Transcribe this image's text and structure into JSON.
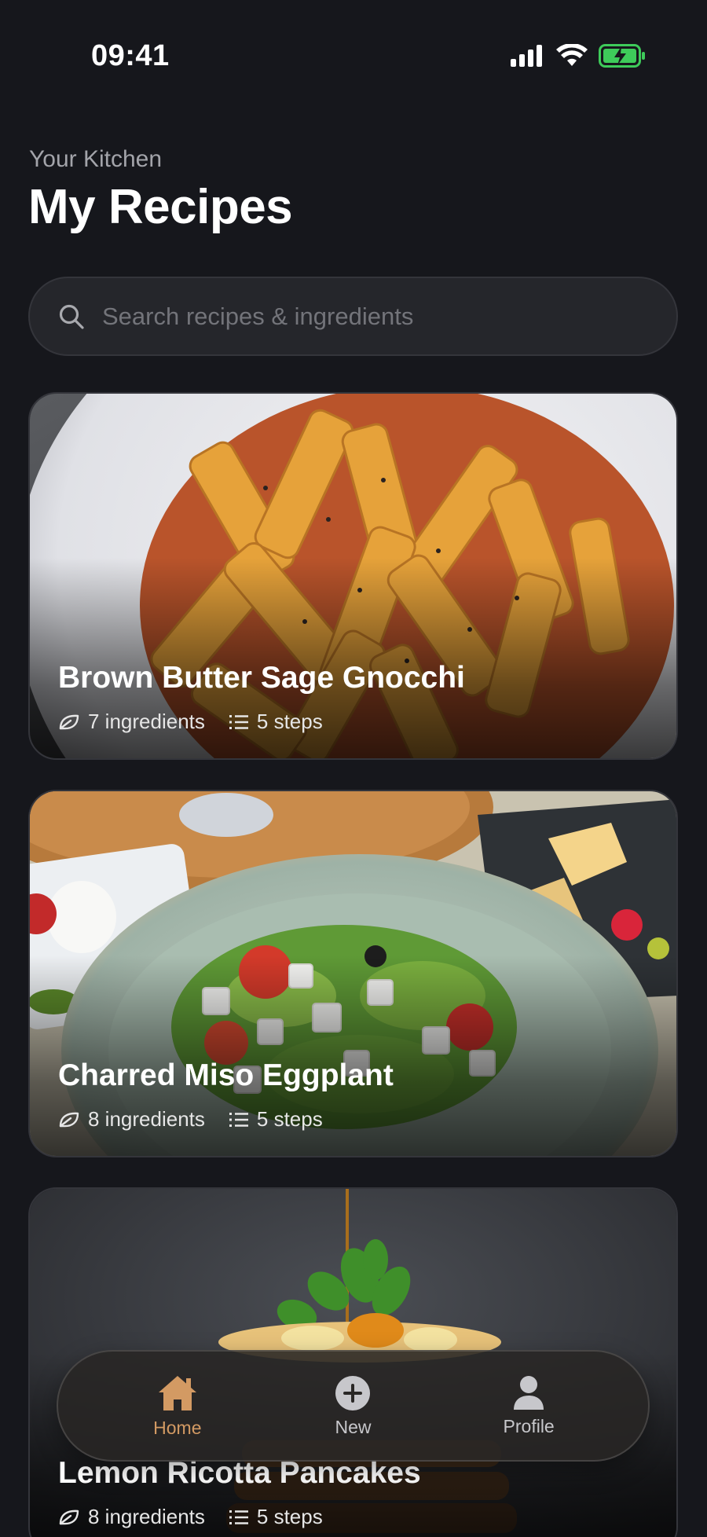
{
  "status_bar": {
    "time": "09:41"
  },
  "header": {
    "subtitle": "Your Kitchen",
    "title": "My Recipes"
  },
  "search": {
    "placeholder": "Search recipes & ingredients",
    "value": ""
  },
  "recipes": [
    {
      "name": "Brown Butter Sage Gnocchi",
      "ingredients": "7 ingredients",
      "steps": "5 steps"
    },
    {
      "name": "Charred Miso Eggplant",
      "ingredients": "8 ingredients",
      "steps": "5 steps"
    },
    {
      "name": "Lemon Ricotta Pancakes",
      "ingredients": "8 ingredients",
      "steps": "5 steps"
    }
  ],
  "tab_bar": {
    "items": [
      {
        "label": "Home",
        "icon": "home-icon",
        "active": true
      },
      {
        "label": "New",
        "icon": "plus-circle-icon",
        "active": false
      },
      {
        "label": "Profile",
        "icon": "person-icon",
        "active": false
      }
    ]
  },
  "colors": {
    "accent": "#d39a63",
    "background": "#16171c",
    "search_bg": "#25262b"
  }
}
